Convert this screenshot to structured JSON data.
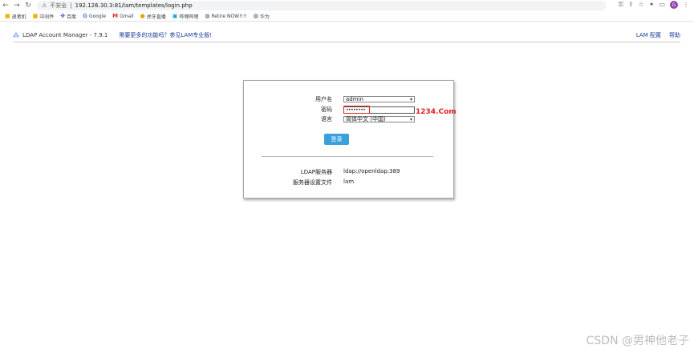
{
  "browser": {
    "security_label": "不安全",
    "url": "192.126.30.3:81/lam/templates/login.php",
    "profile_initial": "G"
  },
  "bookmarks": [
    {
      "label": "退者机",
      "icon": "folder-icon"
    },
    {
      "label": "中间件",
      "icon": "folder-icon"
    },
    {
      "label": "百度",
      "icon": "baidu-icon"
    },
    {
      "label": "Google",
      "icon": "google-icon"
    },
    {
      "label": "Gmail",
      "icon": "gmail-icon"
    },
    {
      "label": "虎牙直播",
      "icon": "huya-icon"
    },
    {
      "label": "哔哩哔哩",
      "icon": "bilibili-icon"
    },
    {
      "label": "Retire NOW!!!!",
      "icon": "globe-icon"
    },
    {
      "label": "华为",
      "icon": "globe-icon"
    }
  ],
  "header": {
    "title": "LDAP Account Manager - 7.9.1",
    "promo": "需要更多的功能吗？参见LAM专业版!",
    "lam_config": "LAM 配置",
    "help": "帮助"
  },
  "login": {
    "username_label": "用户名",
    "username_value": "admin",
    "password_label": "密码",
    "password_value": "••••••••",
    "language_label": "语言",
    "language_value": "简体中文 (中国)",
    "button_label": "登录",
    "annotation": "1234.Com",
    "server_label": "LDAP服务器",
    "server_value": "ldap://openldap:389",
    "profile_label": "服务器设置文件",
    "profile_value": "lam"
  },
  "watermark": "CSDN @男神他老子",
  "colors": {
    "accent": "#3aa0dc",
    "annotation": "#e02020",
    "link": "#1a3a9a"
  }
}
